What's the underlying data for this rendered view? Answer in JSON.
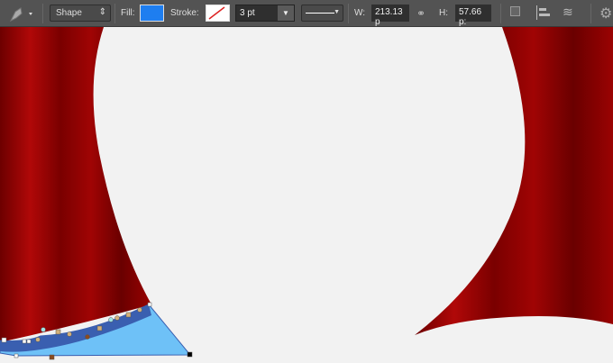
{
  "toolbar": {
    "tool_icon": "pen-tool-icon",
    "mode": "Shape",
    "fill_label": "Fill:",
    "fill_color": "#1e7ef0",
    "stroke_label": "Stroke:",
    "stroke_width": "3 pt",
    "width_label": "W:",
    "width_value": "213.13 p",
    "height_label": "H:",
    "height_value": "57.66 p:"
  },
  "colors": {
    "curtain": "#8a0000",
    "shape_fill": "#6ec1f7",
    "shape_edge": "#3a5fb0"
  }
}
